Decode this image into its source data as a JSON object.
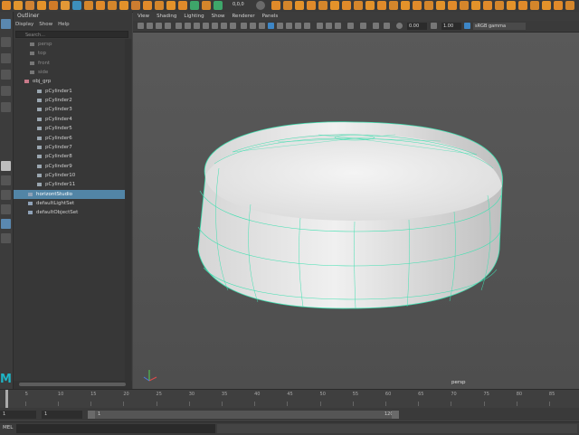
{
  "outliner": {
    "title": "Outliner",
    "menu": [
      "Display",
      "Show",
      "Help"
    ],
    "search_placeholder": "Search...",
    "items": [
      {
        "label": "persp",
        "dim": true
      },
      {
        "label": "top",
        "dim": true
      },
      {
        "label": "front",
        "dim": true
      },
      {
        "label": "side",
        "dim": true
      },
      {
        "label": "obj_grp",
        "dim": false
      },
      {
        "label": "pCylinder1",
        "dim": false
      },
      {
        "label": "pCylinder2",
        "dim": false
      },
      {
        "label": "pCylinder3",
        "dim": false
      },
      {
        "label": "pCylinder4",
        "dim": false
      },
      {
        "label": "pCylinder5",
        "dim": false
      },
      {
        "label": "pCylinder6",
        "dim": false
      },
      {
        "label": "pCylinder7",
        "dim": false
      },
      {
        "label": "pCylinder8",
        "dim": false
      },
      {
        "label": "pCylinder9",
        "dim": false
      },
      {
        "label": "pCylinder10",
        "dim": false
      },
      {
        "label": "pCylinder11",
        "dim": false
      },
      {
        "label": "horizontStudio",
        "dim": false,
        "selected": true
      },
      {
        "label": "defaultLightSet",
        "dim": false
      },
      {
        "label": "defaultObjectSet",
        "dim": false
      }
    ]
  },
  "viewport": {
    "menu": [
      "View",
      "Shading",
      "Lighting",
      "Show",
      "Renderer",
      "Panels"
    ],
    "exposure": "0.00",
    "gamma": "1.00",
    "color_space": "sRGB gamma",
    "camera_label": "persp"
  },
  "shelf": {
    "coords": "0,0,0"
  },
  "timeline": {
    "ticks": [
      "1",
      "5",
      "10",
      "15",
      "20",
      "25",
      "30",
      "35",
      "40",
      "45",
      "50",
      "55",
      "60",
      "65",
      "70",
      "75",
      "80",
      "85"
    ]
  },
  "range": {
    "start": "1",
    "playback_start": "1",
    "slider_start": "1",
    "slider_end": "120"
  },
  "command": {
    "mode": "MEL"
  },
  "colors": {
    "wireframe": "#3fe0b0",
    "selection": "#5285a6",
    "background": "#555555"
  }
}
